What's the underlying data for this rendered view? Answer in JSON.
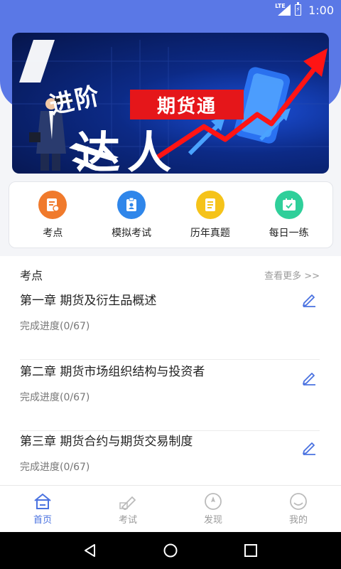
{
  "status_bar": {
    "network": "LTE",
    "battery_glyph": "⚡",
    "time": "1:00"
  },
  "banner": {
    "line1": "进阶",
    "line2": "达人",
    "tag": "期货通"
  },
  "quick_actions": [
    {
      "label": "考点",
      "icon": "note-icon",
      "color": "#f07a2c"
    },
    {
      "label": "模拟考试",
      "icon": "clipboard-user-icon",
      "color": "#2f86ea"
    },
    {
      "label": "历年真题",
      "icon": "document-icon",
      "color": "#f5c31a"
    },
    {
      "label": "每日一练",
      "icon": "calendar-check-icon",
      "color": "#2fcf9a"
    }
  ],
  "section": {
    "title": "考点",
    "more": "查看更多 >>",
    "chapters": [
      {
        "name": "第一章  期货及衍生品概述",
        "progress": "完成进度(0/67)"
      },
      {
        "name": "第二章  期货市场组织结构与投资者",
        "progress": "完成进度(0/67)"
      },
      {
        "name": "第三章  期货合约与期货交易制度",
        "progress": "完成进度(0/67)"
      }
    ]
  },
  "tabs": [
    {
      "label": "首页",
      "icon": "home-icon",
      "active": true
    },
    {
      "label": "考试",
      "icon": "pen-icon",
      "active": false
    },
    {
      "label": "发现",
      "icon": "compass-icon",
      "active": false
    },
    {
      "label": "我的",
      "icon": "smiley-icon",
      "active": false
    }
  ],
  "colors": {
    "primary": "#5a78e6",
    "active_tab": "#4a72e0",
    "accent_red": "#e5161a"
  }
}
